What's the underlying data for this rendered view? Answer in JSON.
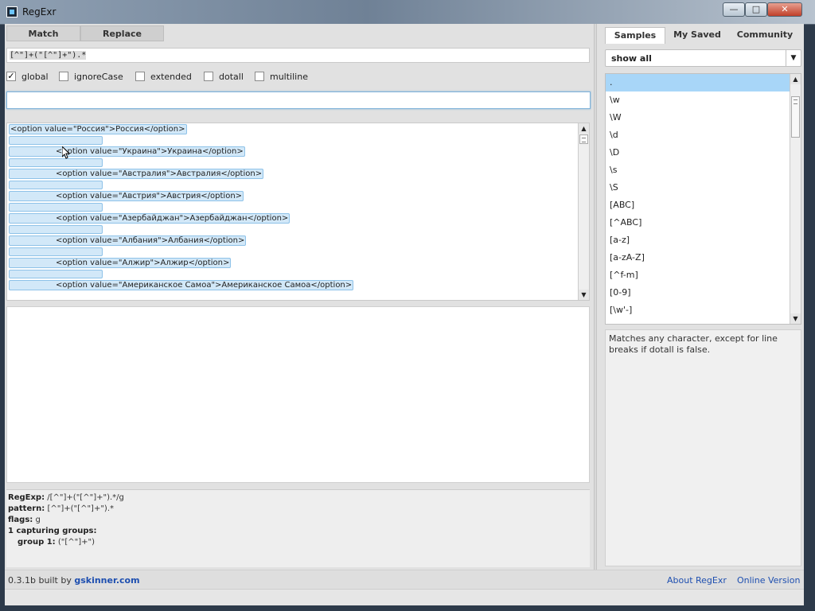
{
  "window": {
    "title": "RegExr"
  },
  "left": {
    "tabs": [
      "Match",
      "Replace"
    ],
    "regex_value": "[^\"]+(\"[^\"]+\").*",
    "flags": [
      {
        "label": "global",
        "checked": true
      },
      {
        "label": "ignoreCase",
        "checked": false
      },
      {
        "label": "extended",
        "checked": false
      },
      {
        "label": "dotall",
        "checked": false
      },
      {
        "label": "multiline",
        "checked": false
      }
    ],
    "replace_value": "",
    "lines": [
      "<option  value=\"Россия\">Россия</option>",
      "<option  value=\"Украина\">Украина</option>",
      "<option  value=\"Австралия\">Австралия</option>",
      "<option  value=\"Австрия\">Австрия</option>",
      "<option  value=\"Азербайджан\">Азербайджан</option>",
      "<option  value=\"Албания\">Албания</option>",
      "<option  value=\"Алжир\">Алжир</option>",
      "<option  value=\"Американское Самоа\">Американское Самоа</option>"
    ],
    "info": {
      "regexp_label": "RegExp:",
      "regexp_value": "/[^\"]+(\"[^\"]+\").*/g",
      "pattern_label": "pattern:",
      "pattern_value": "[^\"]+(\"[^\"]+\").*",
      "flags_label": "flags:",
      "flags_value": "g",
      "groups_label": "1 capturing groups:",
      "group1_label": "group 1:",
      "group1_value": "(\"[^\"]+\")"
    }
  },
  "footer": {
    "version_text": "0.3.1b built by ",
    "version_link": "gskinner.com",
    "about": "About RegExr",
    "online": "Online Version"
  },
  "right": {
    "tabs": [
      "Samples",
      "My Saved",
      "Community"
    ],
    "select_value": "show all",
    "samples": [
      ".",
      "\\w",
      "\\W",
      "\\d",
      "\\D",
      "\\s",
      "\\S",
      "[ABC]",
      "[^ABC]",
      "[a-z]",
      "[a-zA-Z]",
      "[^f-m]",
      "[0-9]",
      "[\\w'-]"
    ],
    "description": "Matches any character, except for line breaks if dotall is false."
  }
}
